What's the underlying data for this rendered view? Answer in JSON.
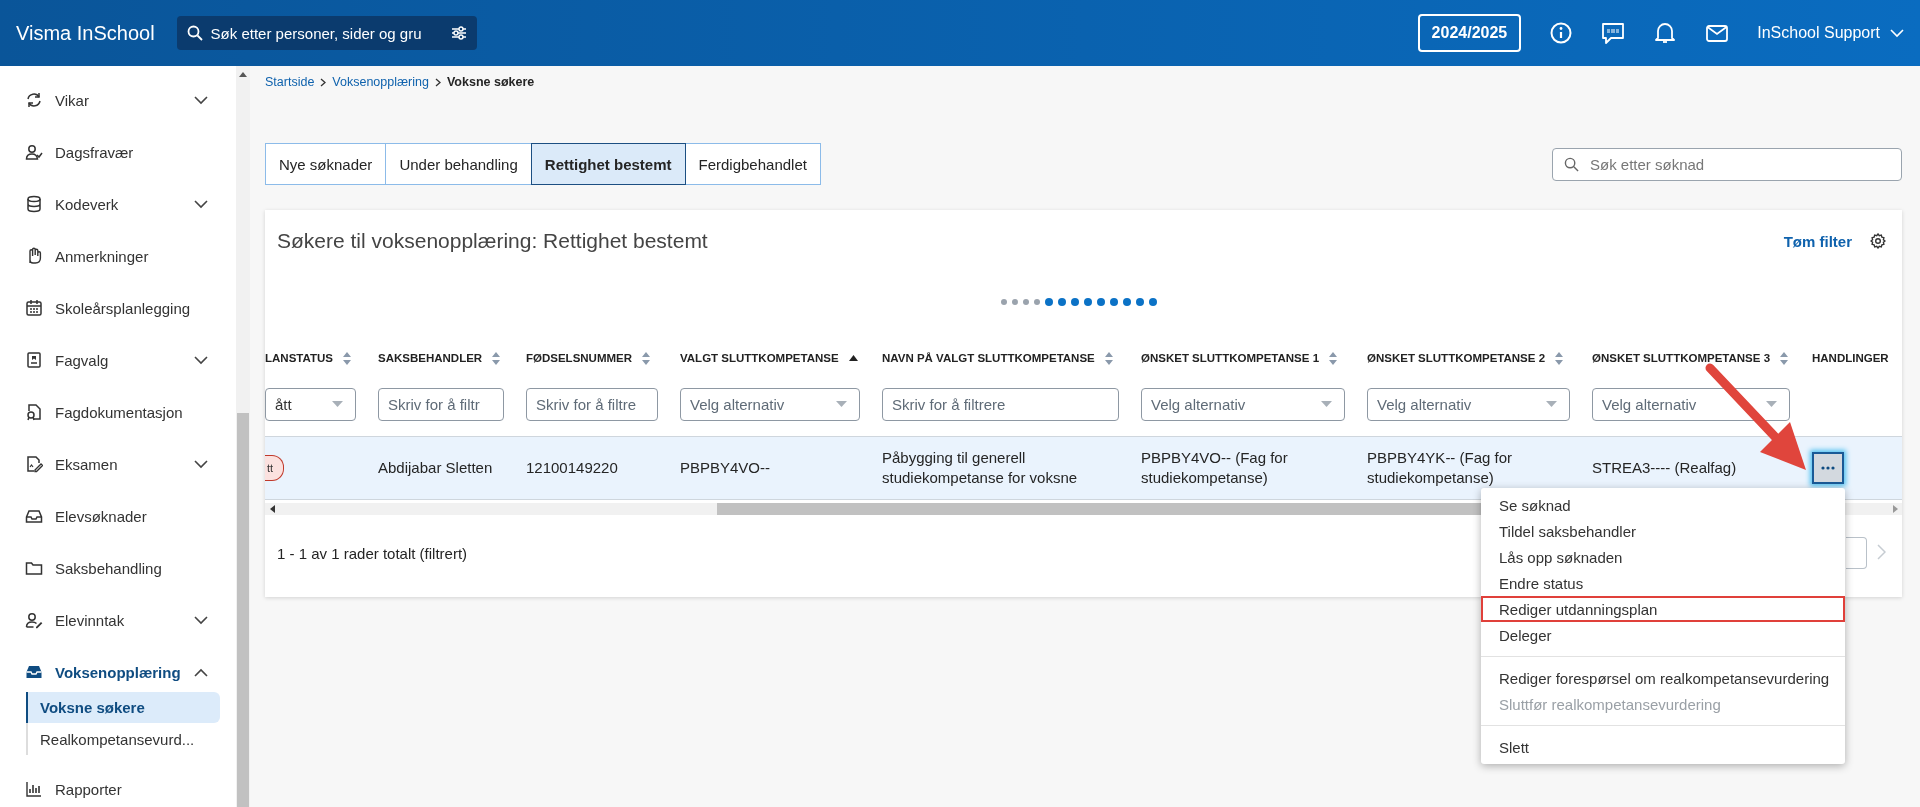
{
  "app": {
    "title": "Visma InSchool",
    "search": {
      "placeholder": "Søk etter personer, sider og gru"
    },
    "school_year": "2024/2025",
    "user": "InSchool Support"
  },
  "sidebar": {
    "items": [
      {
        "label": "Vikar",
        "selected": false,
        "expanded": false
      },
      {
        "label": "Dagsfravær",
        "selected": false
      },
      {
        "label": "Kodeverk",
        "selected": false,
        "expanded": false
      },
      {
        "label": "Anmerkninger",
        "selected": false
      },
      {
        "label": "Skoleårsplanlegging",
        "selected": false
      },
      {
        "label": "Fagvalg",
        "selected": false,
        "expanded": false
      },
      {
        "label": "Fagdokumentasjon",
        "selected": false
      },
      {
        "label": "Eksamen",
        "selected": false,
        "expanded": false
      },
      {
        "label": "Elevsøknader",
        "selected": false
      },
      {
        "label": "Saksbehandling",
        "selected": false
      },
      {
        "label": "Elevinntak",
        "selected": false,
        "expanded": false
      },
      {
        "label": "Voksenopplæring",
        "selected": true,
        "expanded": true,
        "children": [
          {
            "label": "Voksne søkere",
            "selected": true
          },
          {
            "label": "Realkompetansevurd...",
            "selected": false
          }
        ]
      },
      {
        "label": "Rapporter",
        "selected": false
      }
    ]
  },
  "breadcrumb": [
    "Startside",
    "Voksenopplæring",
    "Voksne søkere"
  ],
  "tabs": [
    {
      "label": "Nye søknader",
      "selected": false
    },
    {
      "label": "Under behandling",
      "selected": false
    },
    {
      "label": "Rettighet bestemt",
      "selected": true
    },
    {
      "label": "Ferdigbehandlet",
      "selected": false
    }
  ],
  "search": {
    "placeholder": "Søk etter søknad"
  },
  "card": {
    "title": "Søkere til voksenopplæring: Rettighet bestemt",
    "clear_filter": "Tøm filter",
    "scroll_dots": [
      {
        "active": false
      },
      {
        "active": false
      },
      {
        "active": false
      },
      {
        "active": false
      },
      {
        "active": true
      },
      {
        "active": true
      },
      {
        "active": true
      },
      {
        "active": true
      },
      {
        "active": true
      },
      {
        "active": true
      },
      {
        "active": true
      },
      {
        "active": true
      },
      {
        "active": true
      }
    ],
    "table": {
      "columns": [
        {
          "label": "LANSTATUS",
          "sortable": true,
          "sorted_ascending": false,
          "filter": {
            "kind": "select",
            "value": "ått"
          }
        },
        {
          "label": "SAKSBEHANDLER",
          "sortable": true,
          "sorted_ascending": false,
          "filter": {
            "kind": "text",
            "placeholder": "Skriv for å filtr"
          }
        },
        {
          "label": "FØDSELSNUMMER",
          "sortable": true,
          "sorted_ascending": false,
          "filter": {
            "kind": "text",
            "placeholder": "Skriv for å filtre"
          }
        },
        {
          "label": "VALGT SLUTTKOMPETANSE",
          "sortable": true,
          "sorted_ascending": true,
          "filter": {
            "kind": "select",
            "placeholder": "Velg alternativ"
          }
        },
        {
          "label": "NAVN PÅ VALGT SLUTTKOMPETANSE",
          "sortable": true,
          "sorted_ascending": false,
          "filter": {
            "kind": "text",
            "placeholder": "Skriv for å filtrere"
          }
        },
        {
          "label": "ØNSKET SLUTTKOMPETANSE 1",
          "sortable": true,
          "sorted_ascending": false,
          "filter": {
            "kind": "select",
            "placeholder": "Velg alternativ"
          }
        },
        {
          "label": "ØNSKET SLUTTKOMPETANSE 2",
          "sortable": true,
          "sorted_ascending": false,
          "filter": {
            "kind": "select",
            "placeholder": "Velg alternativ"
          }
        },
        {
          "label": "ØNSKET SLUTTKOMPETANSE 3",
          "sortable": true,
          "sorted_ascending": false,
          "filter": {
            "kind": "select",
            "placeholder": "Velg alternativ"
          }
        },
        {
          "label": "HANDLINGER"
        }
      ],
      "rows": [
        {
          "selected": true,
          "cells": [
            {
              "kind": "badge",
              "text": "tt"
            },
            {
              "kind": "text",
              "text": "Abdijabar Sletten"
            },
            {
              "kind": "text",
              "text": "12100149220"
            },
            {
              "kind": "text",
              "text": "PBPBY4VO--"
            },
            {
              "kind": "text",
              "text": "Påbygging til generell studiekompetanse for voksne"
            },
            {
              "kind": "text",
              "text": "PBPBY4VO-- (Fag for studiekompetanse)"
            },
            {
              "kind": "text",
              "text": "PBPBY4YK-- (Fag for studiekompetanse)"
            },
            {
              "kind": "text",
              "text": "STREA3---- (Realfag)"
            },
            {
              "kind": "action"
            }
          ]
        }
      ]
    },
    "footer": "1 - 1 av 1 rader totalt (filtrert)",
    "pagination": {
      "next_disabled": true
    },
    "action_menu": [
      [
        {
          "label": "Se søknad",
          "disabled": false,
          "highlighted": false
        },
        {
          "label": "Tildel saksbehandler",
          "disabled": false,
          "highlighted": false
        },
        {
          "label": "Lås opp søknaden",
          "disabled": false,
          "highlighted": false
        },
        {
          "label": "Endre status",
          "disabled": false,
          "highlighted": false
        },
        {
          "label": "Rediger utdanningsplan",
          "disabled": false,
          "highlighted": true
        },
        {
          "label": "Deleger",
          "disabled": false,
          "highlighted": false
        }
      ],
      [
        {
          "label": "Rediger forespørsel om realkompetansevurdering",
          "disabled": false,
          "highlighted": false
        },
        {
          "label": "Sluttfør realkompetansevurdering",
          "disabled": true,
          "highlighted": false
        }
      ],
      [
        {
          "label": "Slett",
          "disabled": false,
          "highlighted": false
        }
      ]
    ]
  }
}
